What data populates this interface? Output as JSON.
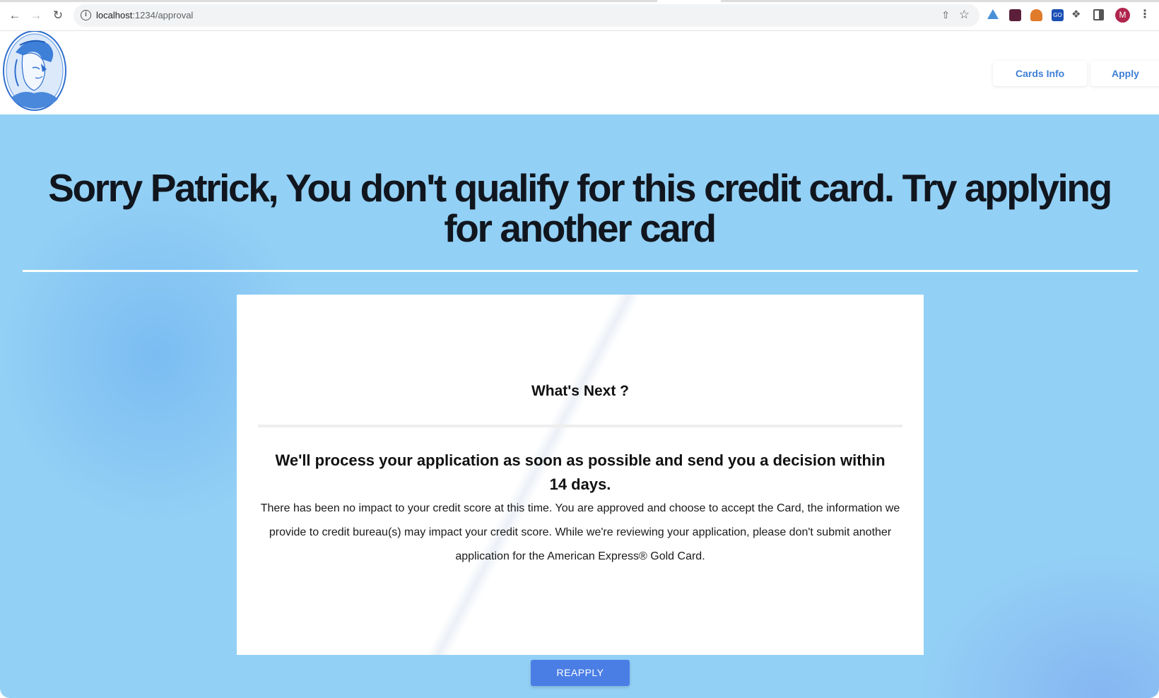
{
  "browser": {
    "url_host": "localhost",
    "url_path": ":1234/approval",
    "avatar_letter": "M",
    "ext_go_label": "GO"
  },
  "header": {
    "nav": [
      {
        "label": "Cards Info"
      },
      {
        "label": "Apply"
      }
    ]
  },
  "hero": {
    "headline": "Sorry Patrick, You don't qualify for this credit card. Try applying for another card"
  },
  "card": {
    "title": "What's Next ?",
    "lead": "We'll process your application as soon as possible and send you a decision within 14 days.",
    "body": "There has been no impact to your credit score at this time. You are approved and choose to accept the Card, the information we provide to credit bureau(s) may impact your credit score. While we're reviewing your application, please don't submit another application for the American Express® Gold Card."
  },
  "actions": {
    "reapply_label": "REAPPLY"
  },
  "colors": {
    "hero_bg": "#93d0f5",
    "accent": "#4a7ee5",
    "nav_link": "#3d7fd6"
  }
}
